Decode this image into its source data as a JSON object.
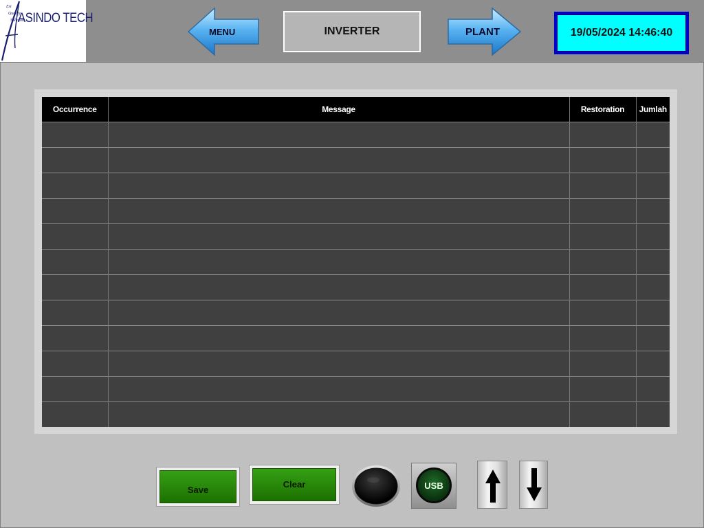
{
  "header": {
    "logo": {
      "brand": "ASINDO TECH",
      "motto": [
        "Est",
        "Quality",
        "Solution"
      ]
    },
    "nav_left_label": "MENU",
    "page_title": "INVERTER",
    "nav_right_label": "PLANT",
    "datetime": "19/05/2024 14:46:40"
  },
  "alarm_table": {
    "columns": [
      "Occurrence",
      "Message",
      "Restoration",
      "Jumlah"
    ],
    "rows": [
      [
        "",
        "",
        "",
        ""
      ],
      [
        "",
        "",
        "",
        ""
      ],
      [
        "",
        "",
        "",
        ""
      ],
      [
        "",
        "",
        "",
        ""
      ],
      [
        "",
        "",
        "",
        ""
      ],
      [
        "",
        "",
        "",
        ""
      ],
      [
        "",
        "",
        "",
        ""
      ],
      [
        "",
        "",
        "",
        ""
      ],
      [
        "",
        "",
        "",
        ""
      ],
      [
        "",
        "",
        "",
        ""
      ],
      [
        "",
        "",
        "",
        ""
      ],
      [
        "",
        "",
        "",
        ""
      ]
    ]
  },
  "controls": {
    "save_label": "Save",
    "clear_label": "Clear",
    "usb_label": "USB",
    "lamp_state": "off",
    "scroll_up_icon": "arrow-up-icon",
    "scroll_down_icon": "arrow-down-icon"
  },
  "colors": {
    "datetime_bg": "#00ffff",
    "datetime_border": "#0000c8",
    "button_green": "#2a8c0a",
    "table_bg": "#404040",
    "table_header_bg": "#000000"
  }
}
